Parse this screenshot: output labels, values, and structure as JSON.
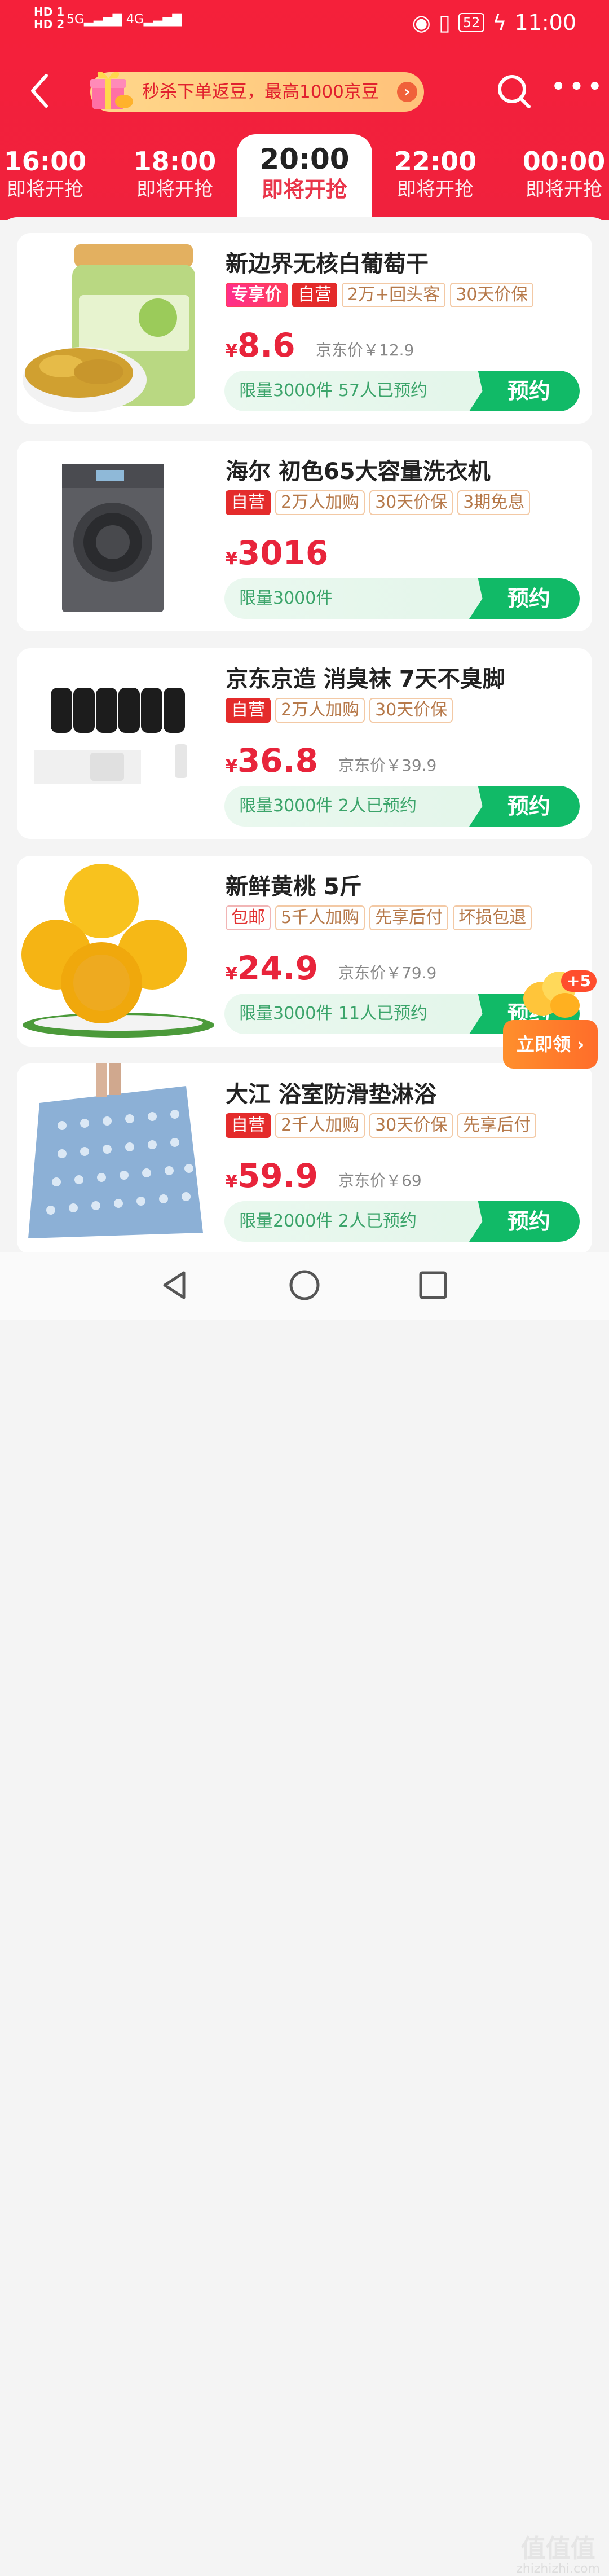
{
  "status_bar": {
    "hd1": "HD 1",
    "hd2": "HD 2",
    "signal1": "5G",
    "signal2": "4G",
    "battery": "52",
    "time": "11:00"
  },
  "nav": {
    "promo_text": "秒杀下单返豆，最高1000京豆"
  },
  "tabs": [
    {
      "time": "16:00",
      "status": "即将开抢"
    },
    {
      "time": "18:00",
      "status": "即将开抢"
    },
    {
      "time": "20:00",
      "status": "即将开抢"
    },
    {
      "time": "22:00",
      "status": "即将开抢"
    },
    {
      "time": "00:00",
      "status": "即将开抢"
    }
  ],
  "products": [
    {
      "title": "新边界无核白葡萄干",
      "tags": [
        "专享价",
        "自营",
        "2万+回头客",
        "30天价保"
      ],
      "currency": "¥",
      "price": "8.6",
      "jd_price": "京东价￥12.9",
      "limit": "限量3000件 57人已预约",
      "button": "预约"
    },
    {
      "title": "海尔 初色65大容量洗衣机",
      "tags": [
        "自营",
        "2万人加购",
        "30天价保",
        "3期免息"
      ],
      "currency": "¥",
      "price": "3016",
      "jd_price": "",
      "limit": "限量3000件",
      "button": "预约"
    },
    {
      "title": "京东京造 消臭袜 7天不臭脚",
      "tags": [
        "自营",
        "2万人加购",
        "30天价保"
      ],
      "currency": "¥",
      "price": "36.8",
      "jd_price": "京东价￥39.9",
      "limit": "限量3000件 2人已预约",
      "button": "预约"
    },
    {
      "title": "新鲜黄桃 5斤",
      "tags": [
        "包邮",
        "5千人加购",
        "先享后付",
        "坏损包退"
      ],
      "currency": "¥",
      "price": "24.9",
      "jd_price": "京东价￥79.9",
      "limit": "限量3000件 11人已预约",
      "button": "预约"
    },
    {
      "title": "大江 浴室防滑垫淋浴",
      "tags": [
        "自营",
        "2千人加购",
        "30天价保",
        "先享后付"
      ],
      "currency": "¥",
      "price": "59.9",
      "jd_price": "京东价￥69",
      "limit": "限量2000件 2人已预约",
      "button": "预约"
    }
  ],
  "float_widget": {
    "badge": "+5",
    "button": "立即领"
  },
  "watermark": {
    "big": "值值值",
    "small": "zhizhizhi.com"
  },
  "colors": {
    "header_red": "#f0213d",
    "price_red": "#e8243b",
    "reserve_green": "#11ba67",
    "promo_gold": "#ffc27a"
  }
}
